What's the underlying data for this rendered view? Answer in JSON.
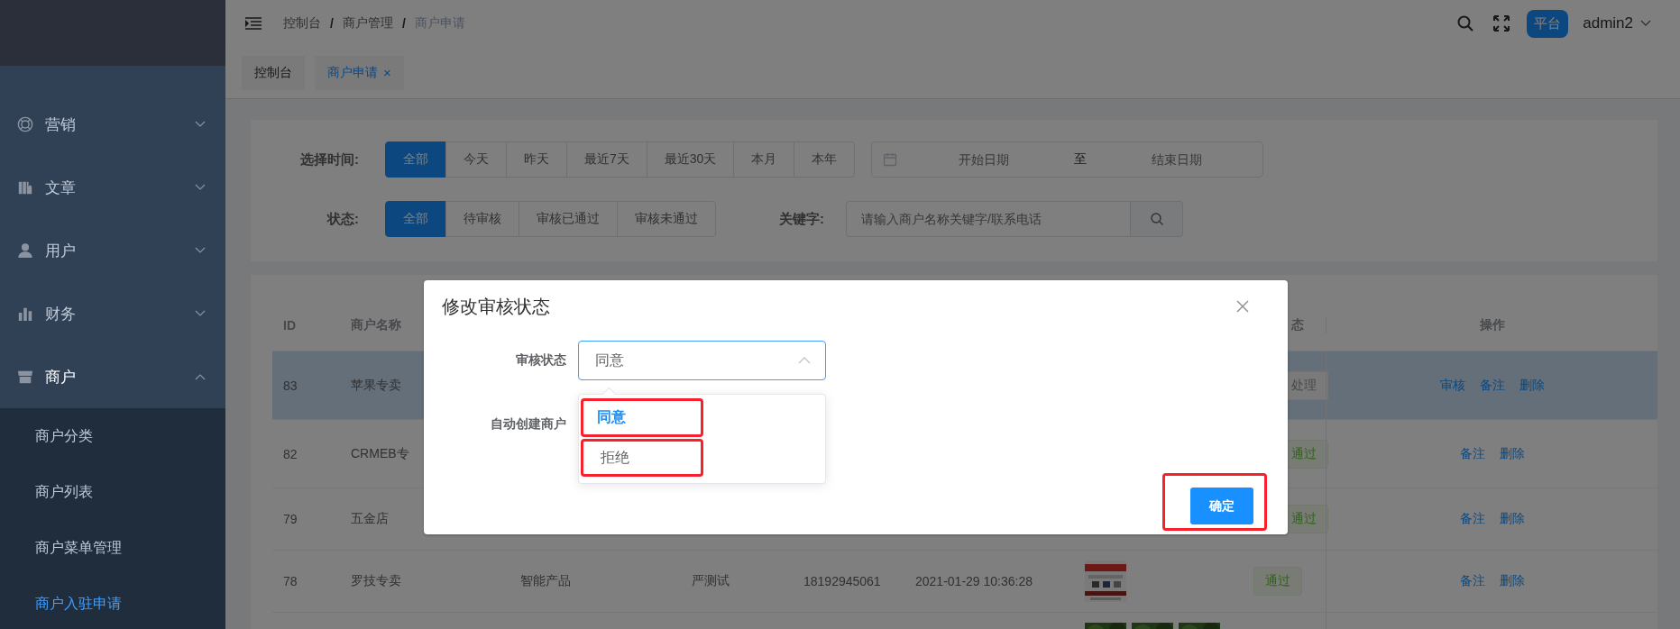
{
  "sidebar": {
    "items": [
      {
        "label": "营销",
        "expanded": false
      },
      {
        "label": "文章",
        "expanded": false
      },
      {
        "label": "用户",
        "expanded": false
      },
      {
        "label": "财务",
        "expanded": false
      },
      {
        "label": "商户",
        "expanded": true,
        "children": [
          {
            "label": "商户分类",
            "selected": false
          },
          {
            "label": "商户列表",
            "selected": false
          },
          {
            "label": "商户菜单管理",
            "selected": false
          },
          {
            "label": "商户入驻申请",
            "selected": true
          }
        ]
      }
    ]
  },
  "header": {
    "breadcrumb": [
      {
        "label": "控制台",
        "separator": "/"
      },
      {
        "label": "商户管理",
        "separator": "/"
      },
      {
        "label": "商户申请"
      }
    ],
    "role_badge": "平台",
    "user": "admin2"
  },
  "tags": [
    {
      "label": "控制台",
      "selected": false
    },
    {
      "label": "商户申请",
      "selected": true,
      "close": "×"
    }
  ],
  "filters": {
    "time": {
      "label": "选择时间:",
      "options": [
        {
          "label": "全部",
          "selected": true
        },
        {
          "label": "今天",
          "selected": false
        },
        {
          "label": "昨天",
          "selected": false
        },
        {
          "label": "最近7天",
          "selected": false
        },
        {
          "label": "最近30天",
          "selected": false
        },
        {
          "label": "本月",
          "selected": false
        },
        {
          "label": "本年",
          "selected": false
        }
      ]
    },
    "date_range": {
      "start_placeholder": "开始日期",
      "separator": "至",
      "end_placeholder": "结束日期"
    },
    "status": {
      "label": "状态:",
      "options": [
        {
          "label": "全部",
          "selected": true
        },
        {
          "label": "待审核",
          "selected": false
        },
        {
          "label": "审核已通过",
          "selected": false
        },
        {
          "label": "审核未通过",
          "selected": false
        }
      ]
    },
    "keyword": {
      "label": "关键字:",
      "placeholder": "请输入商户名称关键字/联系电话"
    }
  },
  "table": {
    "header": {
      "id": "ID",
      "name": "商户名称",
      "status": "态",
      "actions": "操作"
    },
    "rows": [
      {
        "id": "83",
        "name": "苹果专卖",
        "status": {
          "label": "处理",
          "kind": "pending"
        },
        "actions": [
          "审核",
          "备注",
          "删除"
        ],
        "selected": true
      },
      {
        "id": "82",
        "name": "CRMEB专",
        "status": {
          "label": "通过",
          "kind": "approved"
        },
        "actions": [
          "备注",
          "删除"
        ],
        "selected": false
      },
      {
        "id": "79",
        "name": "五金店",
        "status": {
          "label": "通过",
          "kind": "approved"
        },
        "actions": [
          "备注",
          "删除"
        ],
        "selected": false
      },
      {
        "id": "78",
        "name": "罗技专卖",
        "column_3": "智能产品",
        "column_4": "严测试",
        "phone": "18192945061",
        "date": "2021-01-29 10:36:28",
        "images": [
          {
            "kind": "picture"
          }
        ],
        "status": {
          "label": "通过",
          "kind": "approved"
        },
        "actions": [
          "备注",
          "删除"
        ],
        "selected": false
      },
      {
        "images": [
          {
            "kind": "picture"
          },
          {
            "kind": "picture"
          },
          {
            "kind": "picture"
          }
        ],
        "selected": false
      }
    ]
  },
  "modal": {
    "title": "修改审核状态",
    "fields": [
      {
        "label": "审核状态",
        "value": "同意",
        "open": true
      },
      {
        "label": "自动创建商户"
      }
    ],
    "dropdown": [
      {
        "label": "同意",
        "selected": true,
        "highlighted": true
      },
      {
        "label": "拒绝",
        "selected": false,
        "highlighted": true
      }
    ],
    "confirm": {
      "label": "确定",
      "highlighted": true
    }
  }
}
